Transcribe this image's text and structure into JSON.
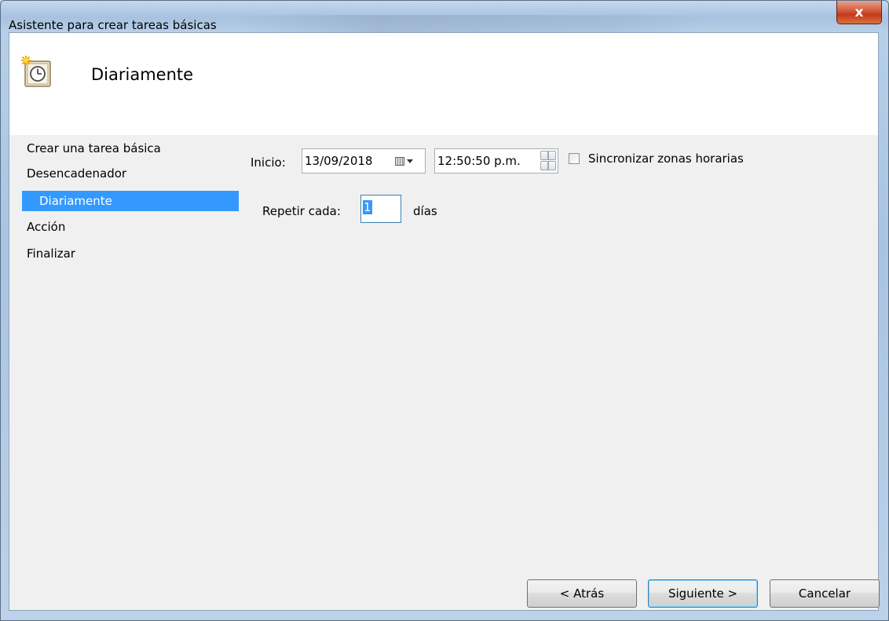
{
  "window": {
    "title": "Asistente para crear tareas básicas",
    "close_label": "x"
  },
  "header": {
    "title": "Diariamente",
    "icon": "scheduled-task-clock-icon"
  },
  "steps": [
    {
      "label": "Crear una tarea básica",
      "selected": false
    },
    {
      "label": "Desencadenador",
      "selected": false
    },
    {
      "label": "Diariamente",
      "selected": true
    },
    {
      "label": "Acción",
      "selected": false
    },
    {
      "label": "Finalizar",
      "selected": false
    }
  ],
  "form": {
    "start_label": "Inicio:",
    "start_date": "13/09/2018",
    "start_time": "12:50:50 p.m.",
    "sync_label": "Sincronizar zonas horarias",
    "sync_checked": false,
    "repeat_label": "Repetir cada:",
    "repeat_value": "1",
    "repeat_unit": "días"
  },
  "buttons": {
    "back": "< Atrás",
    "next": "Siguiente >",
    "cancel": "Cancelar"
  },
  "colors": {
    "selection": "#3399ff",
    "close_button": "#c3391b"
  }
}
